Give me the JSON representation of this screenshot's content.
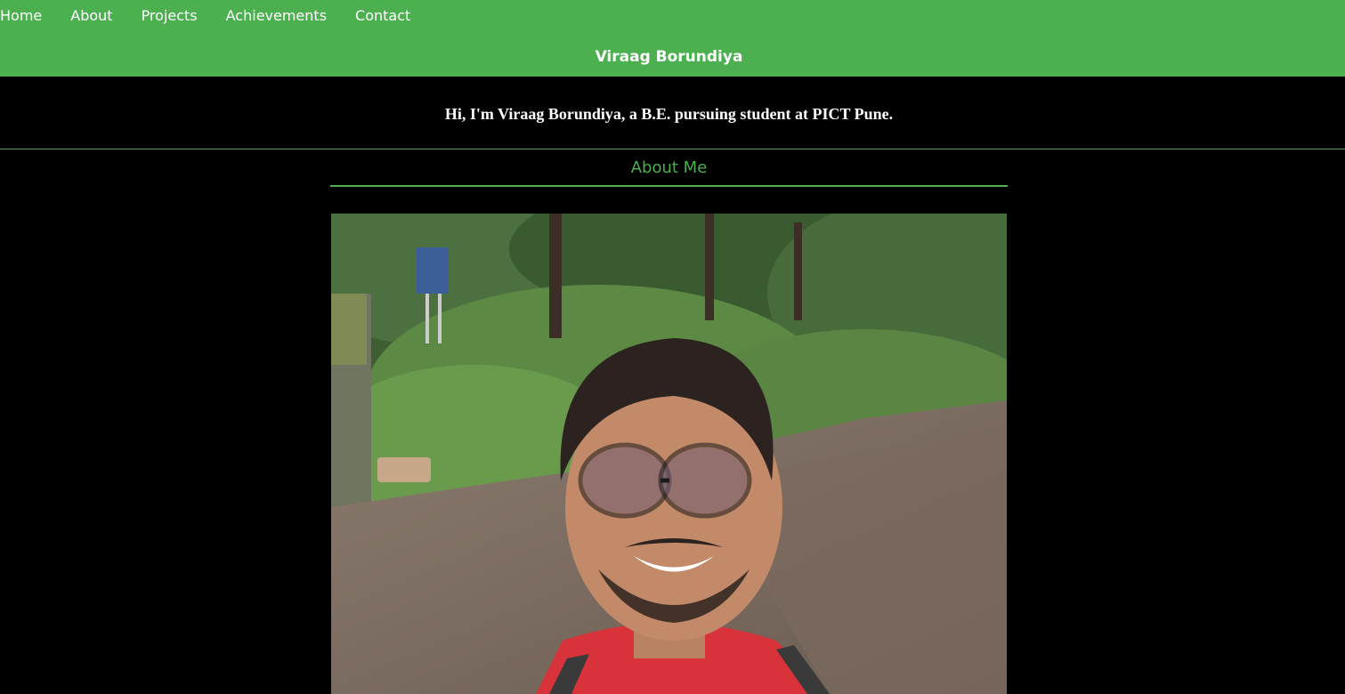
{
  "nav": {
    "items": [
      {
        "label": "Home"
      },
      {
        "label": "About"
      },
      {
        "label": "Projects"
      },
      {
        "label": "Achievements"
      },
      {
        "label": "Contact"
      }
    ]
  },
  "header": {
    "site_title": "Viraag Borundiya"
  },
  "intro": {
    "text": "Hi, I'm Viraag Borundiya, a B.E. pursuing student at PICT Pune."
  },
  "about": {
    "title": "About Me"
  },
  "colors": {
    "accent": "#4caf50",
    "background": "#000000",
    "text": "#ffffff"
  }
}
